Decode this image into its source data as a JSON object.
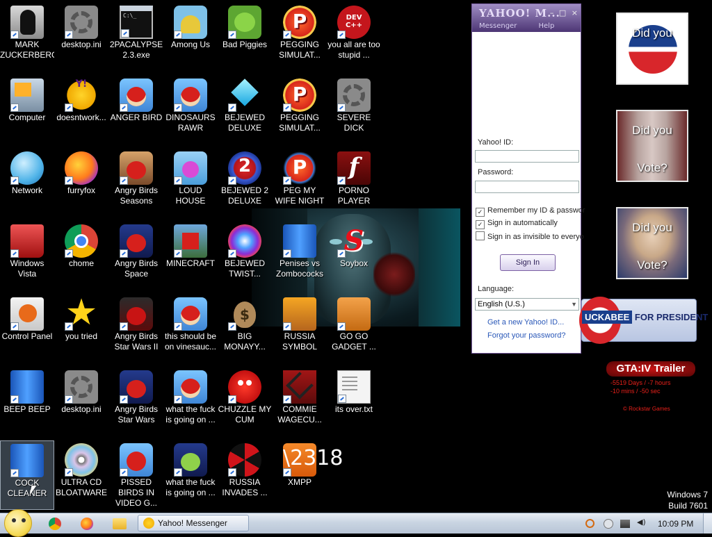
{
  "desktop": {
    "icons": [
      {
        "label": "MARK ZUCKERBERG",
        "glyph": "g-folder-tux",
        "name": "mark-zuckerberg-icon"
      },
      {
        "label": "desktop.ini",
        "glyph": "g-gear",
        "name": "desktop-ini-icon"
      },
      {
        "label": "2PACALYPSE 2.3.exe",
        "glyph": "g-cmd",
        "name": "2pacalypse-icon"
      },
      {
        "label": "Among Us",
        "glyph": "g-amongus",
        "name": "among-us-icon"
      },
      {
        "label": "Bad Piggies",
        "glyph": "g-piggies",
        "name": "bad-piggies-icon"
      },
      {
        "label": "PEGGING SIMULAT...",
        "glyph": "g-pegging",
        "name": "pegging-sim-icon-1"
      },
      {
        "label": "you all are too stupid ...",
        "glyph": "g-dev",
        "name": "dev-cpp-icon"
      },
      {
        "label": "Computer",
        "glyph": "g-computer",
        "name": "computer-icon"
      },
      {
        "label": "doesntwork...",
        "glyph": "g-yahoo",
        "name": "yahoo-icon"
      },
      {
        "label": "ANGER BIRD",
        "glyph": "g-angry",
        "name": "anger-bird-icon"
      },
      {
        "label": "DINOSAURS RAWR",
        "glyph": "g-angry",
        "name": "dinosaurs-rawr-icon"
      },
      {
        "label": "BEJEWED DELUXE",
        "glyph": "g-diamond",
        "name": "bejewed-deluxe-icon"
      },
      {
        "label": "PEGGING SIMULAT...",
        "glyph": "g-pegging",
        "name": "pegging-sim-icon-2"
      },
      {
        "label": "SEVERE DICK",
        "glyph": "g-gear",
        "name": "severe-dick-icon"
      },
      {
        "label": "Network",
        "glyph": "g-globe",
        "name": "network-icon"
      },
      {
        "label": "furryfox",
        "glyph": "g-firefox",
        "name": "firefox-icon"
      },
      {
        "label": "Angry Birds Seasons",
        "glyph": "g-angry-seasons",
        "name": "angry-birds-seasons-icon"
      },
      {
        "label": "LOUD HOUSE",
        "glyph": "g-loud",
        "name": "loud-house-icon"
      },
      {
        "label": "BEJEWED 2 DELUXE",
        "glyph": "g-bej2",
        "name": "bejewed2-icon"
      },
      {
        "label": "PEG MY WIFE NIGHT",
        "glyph": "g-pegwife",
        "name": "peg-my-wife-icon"
      },
      {
        "label": "PORNO PLAYER",
        "glyph": "g-flash",
        "name": "flash-player-icon"
      },
      {
        "label": "Windows Vista",
        "glyph": "g-trash",
        "name": "windows-vista-icon"
      },
      {
        "label": "chome",
        "glyph": "g-chrome",
        "name": "chrome-icon"
      },
      {
        "label": "Angry Birds Space",
        "glyph": "g-angry-space",
        "name": "angry-birds-space-icon"
      },
      {
        "label": "MINECRAFT",
        "glyph": "g-minecraft",
        "name": "minecraft-icon"
      },
      {
        "label": "BEJEWED TWIST...",
        "glyph": "g-bejtwist",
        "name": "bejewed-twist-icon"
      },
      {
        "label": "Penises vs Zombococks",
        "glyph": "g-phone",
        "name": "penises-zombo-icon"
      },
      {
        "label": "Soybox",
        "glyph": "g-soybox",
        "name": "soybox-icon"
      },
      {
        "label": "Control Panel",
        "glyph": "g-cpanel",
        "name": "control-panel-icon"
      },
      {
        "label": "you tried",
        "glyph": "g-star",
        "name": "you-tried-icon"
      },
      {
        "label": "Angry Birds Star Wars II",
        "glyph": "g-angry-sw",
        "name": "angry-birds-sw2-icon"
      },
      {
        "label": "this should be on vinesauc...",
        "glyph": "g-angry",
        "name": "vinesauce-icon"
      },
      {
        "label": "BIG MONAYY...",
        "glyph": "g-moneybag",
        "name": "big-money-icon"
      },
      {
        "label": "RUSSIA SYMBOL",
        "glyph": "g-russia",
        "name": "russia-symbol-icon"
      },
      {
        "label": "GO GO GADGET ...",
        "glyph": "g-briefcase",
        "name": "go-go-gadget-icon"
      },
      {
        "label": "BEEP BEEP",
        "glyph": "g-phone",
        "name": "beep-beep-icon"
      },
      {
        "label": "desktop.ini",
        "glyph": "g-gear",
        "name": "desktop-ini-icon-2"
      },
      {
        "label": "Angry Birds Star Wars",
        "glyph": "g-angry-space",
        "name": "angry-birds-sw-icon"
      },
      {
        "label": "what the fuck is going on ...",
        "glyph": "g-angry",
        "name": "wtf-icon-1"
      },
      {
        "label": "CHUZZLE MY CUM",
        "glyph": "g-cum",
        "name": "chuzzle-icon"
      },
      {
        "label": "COMMIE WAGECU...",
        "glyph": "g-commie",
        "name": "commie-icon"
      },
      {
        "label": "its over.txt",
        "glyph": "g-txt",
        "name": "its-over-txt-icon"
      },
      {
        "label": "COCK CLEANER",
        "glyph": "g-phone",
        "name": "cock-cleaner-icon",
        "selected": true
      },
      {
        "label": "ULTRA CD BLOATWARE",
        "glyph": "g-cd",
        "name": "ultra-cd-icon"
      },
      {
        "label": "PISSED BIRDS IN VIDEO G...",
        "glyph": "g-pissed",
        "name": "pissed-birds-icon"
      },
      {
        "label": "what the fuck is going on ...",
        "glyph": "g-wtf2",
        "name": "wtf-icon-2"
      },
      {
        "label": "RUSSIA INVADES ...",
        "glyph": "g-radiation",
        "name": "russia-invades-icon"
      },
      {
        "label": "XMPP",
        "glyph": "g-xampp",
        "name": "xampp-icon"
      }
    ]
  },
  "yahoo": {
    "logo": "YAHOO! M...",
    "menu_messenger": "Messenger",
    "menu_help": "Help",
    "ctrl_min": "–",
    "ctrl_max": "□",
    "ctrl_close": "×",
    "id_label": "Yahoo! ID:",
    "password_label": "Password:",
    "id_value": "",
    "password_value": "",
    "remember_label": "Remember my ID & passwor",
    "auto_label": "Sign in automatically",
    "invisible_label": "Sign in as invisible to everyo",
    "remember_checked": "✓",
    "auto_checked": "✓",
    "invisible_checked": "",
    "signin_label": "Sign In",
    "language_label": "Language:",
    "language_value": "English (U.S.)",
    "get_id_link": "Get a new Yahoo! ID...",
    "forgot_link": "Forgot your password?"
  },
  "widgets": {
    "did_you": "Did you",
    "vote": "Vote?",
    "huck_a": "UCKABEE",
    "huck_b": "FOR PRESIDENT",
    "gta_title": "GTA:IV Trailer",
    "gta_line1": "-5519 Days / -7 hours",
    "gta_line2": "-10 mins / -50 sec",
    "gta_rockstar": "© Rockstar Games"
  },
  "watermark": {
    "line1": "Windows 7",
    "line2": "Build 7601"
  },
  "taskbar": {
    "yahoo_task": "Yahoo! Messenger",
    "clock": "10:09 PM"
  }
}
